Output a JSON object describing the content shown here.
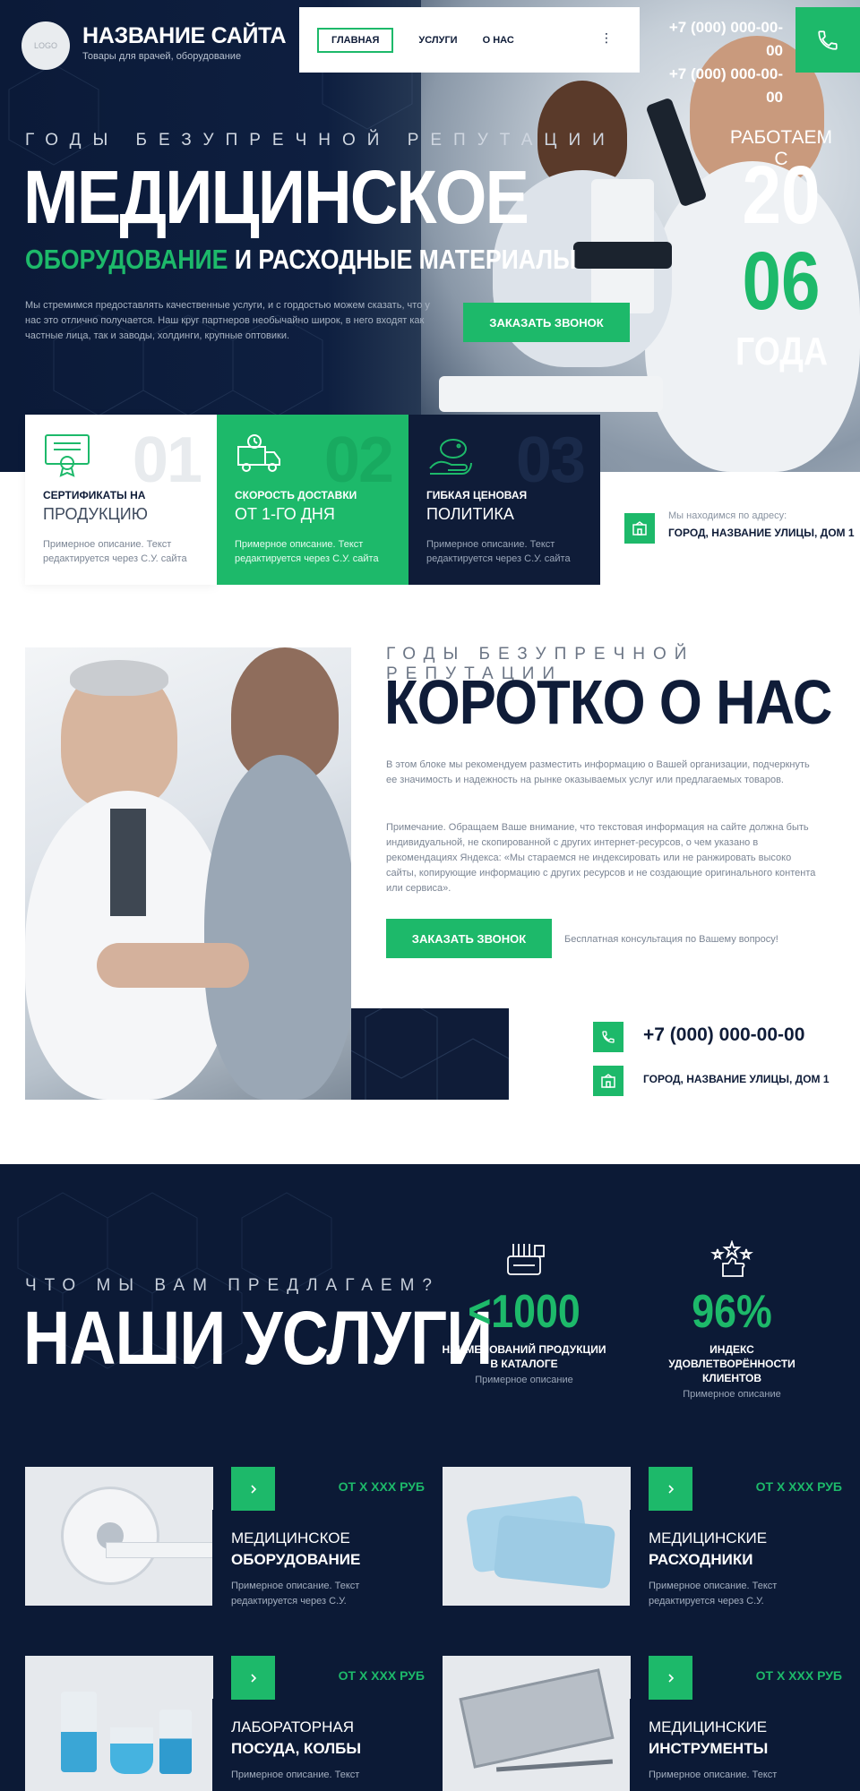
{
  "header": {
    "logo": "LOGO",
    "site_name": "НАЗВАНИЕ САЙТА",
    "tagline": "Товары для врачей, оборудование",
    "nav": [
      "ГЛАВНАЯ",
      "УСЛУГИ",
      "О НАС"
    ],
    "nav_more": "⋮",
    "phones": [
      "+7 (000) 000-00-00",
      "+7 (000) 000-00-00"
    ]
  },
  "hero": {
    "kicker": "ГОДЫ БЕЗУПРЕЧНОЙ РЕПУТАЦИИ",
    "title": "МЕДИЦИНСКОЕ",
    "subtitle_green": "ОБОРУДОВАНИЕ",
    "subtitle_white": " И РАСХОДНЫЕ МАТЕРИАЛЫ",
    "description": "Мы стремимся предоставлять качественные услуги, и с гордостью можем сказать, что у нас это отлично получается. Наш круг партнеров необычайно широк, в него входят как частные лица, так и заводы, холдинги, крупные оптовики.",
    "cta": "ЗАКАЗАТЬ ЗВОНОК",
    "years_label": "РАБОТАЕМ С",
    "year_a": "20",
    "year_b": "06",
    "years_suffix": "ГОДА"
  },
  "features": [
    {
      "num": "01",
      "title": "СЕРТИФИКАТЫ НА",
      "subtitle": "ПРОДУКЦИЮ",
      "desc": "Примерное описание. Текст редактируется через С.У. сайта",
      "icon": "certificate-icon"
    },
    {
      "num": "02",
      "title": "СКОРОСТЬ ДОСТАВКИ",
      "subtitle": "ОТ 1-ГО ДНЯ",
      "desc": "Примерное описание. Текст редактируется через С.У. сайта",
      "icon": "delivery-truck-icon"
    },
    {
      "num": "03",
      "title": "ГИБКАЯ ЦЕНОВАЯ",
      "subtitle": "ПОЛИТИКА",
      "desc": "Примерное описание. Текст редактируется через С.У. сайта",
      "icon": "piggy-bank-icon"
    }
  ],
  "address": {
    "label": "Мы находимся по адресу:",
    "value": "ГОРОД, НАЗВАНИЕ УЛИЦЫ, ДОМ 1"
  },
  "about": {
    "kicker": "ГОДЫ БЕЗУПРЕЧНОЙ РЕПУТАЦИИ",
    "title": "КОРОТКО О НАС",
    "p1": "В этом блоке мы рекомендуем разместить информацию о Вашей организации, подчеркнуть ее значимость и надежность на рынке оказываемых услуг или предлагаемых товаров.",
    "p2": "Примечание. Обращаем Ваше внимание, что текстовая информация на сайте должна быть индивидуальной, не скопированной с других интернет-ресурсов, о чем указано в рекомендациях Яндекса: «Мы стараемся не индексировать или не ранжировать высоко сайты, копирующие информацию с других ресурсов и не создающие оригинального контента или сервиса».",
    "cta": "ЗАКАЗАТЬ ЗВОНОК",
    "cta_note": "Бесплатная консультация по Вашему вопросу!",
    "phone": "+7 (000) 000-00-00",
    "address": "ГОРОД, НАЗВАНИЕ УЛИЦЫ, ДОМ 1"
  },
  "services": {
    "kicker": "ЧТО МЫ ВАМ ПРЕДЛАГАЕМ?",
    "title": "НАШИ УСЛУГИ",
    "stats": [
      {
        "value": "<1000",
        "label": "НАИМЕНОВАНИЙ ПРОДУКЦИИ В КАТАЛОГЕ",
        "desc": "Примерное описание",
        "icon": "catalog-icon"
      },
      {
        "value": "96%",
        "label": "ИНДЕКС УДОВЛЕТВОРЁННОСТИ КЛИЕНТОВ",
        "desc": "Примерное описание",
        "icon": "rating-stars-icon"
      }
    ],
    "cards": [
      {
        "price": "ОТ Х ХХХ РУБ",
        "t1": "МЕДИЦИНСКОЕ",
        "t2": "ОБОРУДОВАНИЕ",
        "desc": "Примерное описание. Текст редактируется через С.У."
      },
      {
        "price": "ОТ Х ХХХ РУБ",
        "t1": "МЕДИЦИНСКИЕ",
        "t2": "РАСХОДНИКИ",
        "desc": "Примерное описание. Текст редактируется через С.У."
      },
      {
        "price": "ОТ Х ХХХ РУБ",
        "t1": "ЛАБОРАТОРНАЯ",
        "t2": "ПОСУДА, КОЛБЫ",
        "desc": "Примерное описание. Текст"
      },
      {
        "price": "ОТ Х ХХХ РУБ",
        "t1": "МЕДИЦИНСКИЕ",
        "t2": "ИНСТРУМЕНТЫ",
        "desc": "Примерное описание. Текст"
      }
    ]
  },
  "colors": {
    "accent": "#1db96a",
    "navy": "#0c1a36"
  }
}
